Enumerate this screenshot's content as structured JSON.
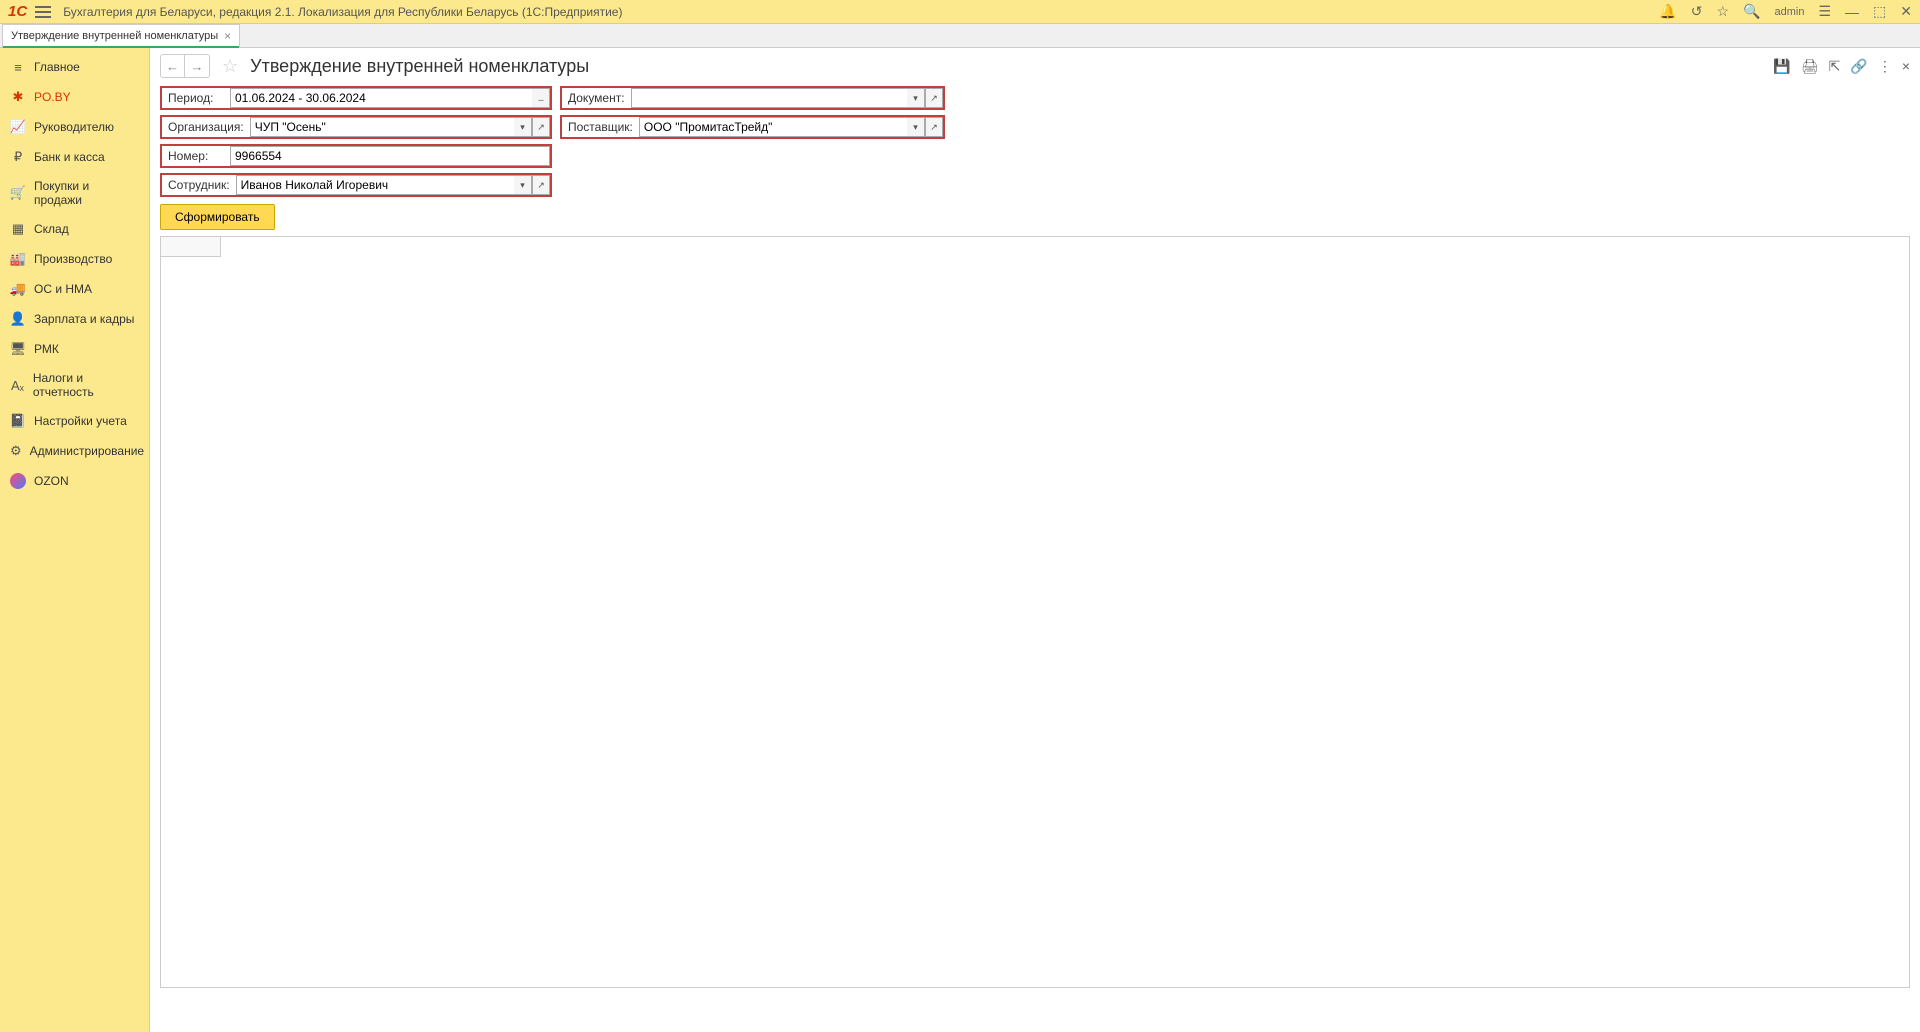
{
  "titlebar": {
    "title": "Бухгалтерия для Беларуси, редакция 2.1. Локализация для Республики Беларусь   (1С:Предприятие)",
    "user": "admin"
  },
  "tab": {
    "label": "Утверждение внутренней номенклатуры"
  },
  "sidebar": {
    "items": [
      {
        "label": "Главное",
        "icon": "≡"
      },
      {
        "label": "PO.BY",
        "icon": "✱",
        "active": true
      },
      {
        "label": "Руководителю",
        "icon": "📈"
      },
      {
        "label": "Банк и касса",
        "icon": "₽"
      },
      {
        "label": "Покупки и продажи",
        "icon": "🛒"
      },
      {
        "label": "Склад",
        "icon": "▦"
      },
      {
        "label": "Производство",
        "icon": "🏭"
      },
      {
        "label": "ОС и НМА",
        "icon": "🚚"
      },
      {
        "label": "Зарплата и кадры",
        "icon": "👤"
      },
      {
        "label": "РМК",
        "icon": "🖥"
      },
      {
        "label": "Налоги и отчетность",
        "icon": "Aₓ"
      },
      {
        "label": "Настройки учета",
        "icon": "📓"
      },
      {
        "label": "Администрирование",
        "icon": "⚙"
      },
      {
        "label": "OZON",
        "icon": "ozon"
      }
    ]
  },
  "page": {
    "title": "Утверждение внутренней номенклатуры"
  },
  "form": {
    "period": {
      "label": "Период:",
      "value": "01.06.2024 - 30.06.2024"
    },
    "document": {
      "label": "Документ:",
      "value": ""
    },
    "organization": {
      "label": "Организация:",
      "value": "ЧУП \"Осень\""
    },
    "supplier": {
      "label": "Поставщик:",
      "value": "ООО \"ПромитасТрейд\""
    },
    "number": {
      "label": "Номер:",
      "value": "9966554"
    },
    "employee": {
      "label": "Сотрудник:",
      "value": "Иванов Николай Игоревич"
    },
    "generate_btn": "Сформировать"
  }
}
